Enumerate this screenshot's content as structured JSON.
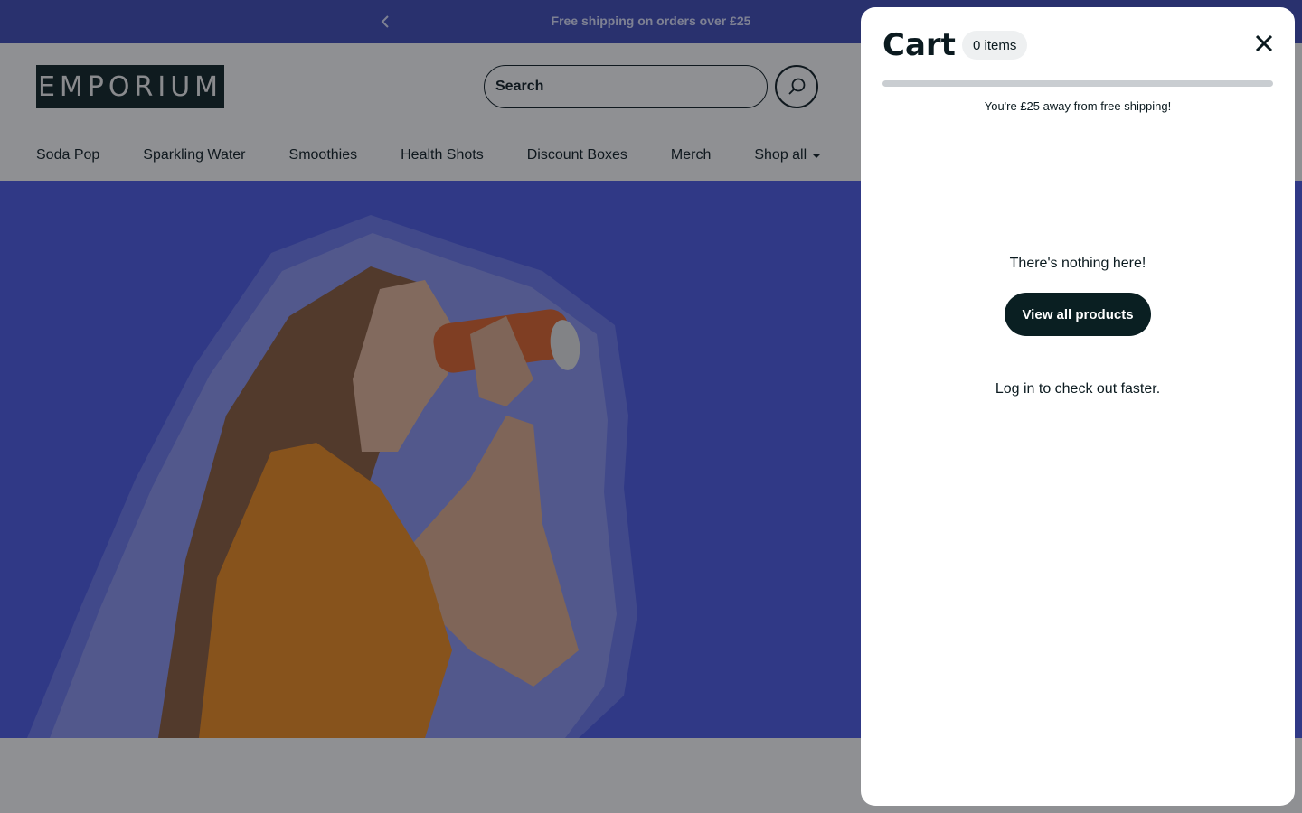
{
  "announcement": {
    "message": "Free shipping on orders over £25",
    "prev_icon": "chevron-left-icon"
  },
  "header": {
    "logo_text": "EMPORIUM",
    "search": {
      "placeholder": "Search",
      "icon": "search-icon"
    },
    "nav": [
      {
        "label": "Soda Pop"
      },
      {
        "label": "Sparkling Water"
      },
      {
        "label": "Smoothies"
      },
      {
        "label": "Health Shots"
      },
      {
        "label": "Discount Boxes"
      },
      {
        "label": "Merch"
      },
      {
        "label": "Shop all",
        "has_dropdown": true
      }
    ]
  },
  "hero": {
    "image": "woman-drinking-from-can",
    "background_color": "#4a59e6"
  },
  "cart": {
    "title": "Cart",
    "item_count_label": "0 items",
    "close_icon": "close-icon",
    "free_shipping_progress": 0,
    "shipping_message": "You're £25 away from free shipping!",
    "empty_message": "There's nothing here!",
    "view_all_label": "View all products",
    "login_link_label": "Log in",
    "login_suffix": " to check out faster."
  },
  "colors": {
    "brand_blue": "#3c49b8",
    "dark": "#0a1f22",
    "track": "#c9cdd1"
  }
}
